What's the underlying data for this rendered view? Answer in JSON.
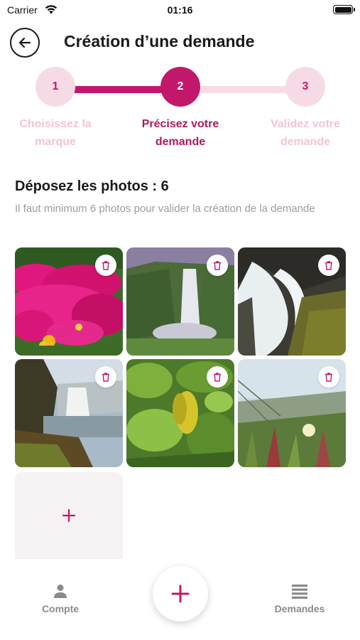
{
  "status_bar": {
    "carrier": "Carrier",
    "time": "01:16",
    "icons": [
      "wifi-icon",
      "battery-icon"
    ]
  },
  "header": {
    "title": "Création d’une demande",
    "back_icon": "arrow-left-icon"
  },
  "stepper": {
    "current_step": 2,
    "steps": [
      {
        "number": "1",
        "label": "Choisissez la marque"
      },
      {
        "number": "2",
        "label": "Précisez votre demande"
      },
      {
        "number": "3",
        "label": "Validez votre demande"
      }
    ]
  },
  "photos_section": {
    "title": "Déposez les photos : 6",
    "subtitle": "Il faut minimum 6 photos pour valider la création de la demande",
    "photos": [
      {
        "subject": "pink-flowers"
      },
      {
        "subject": "waterfall-cliff"
      },
      {
        "subject": "waterfall-rocks"
      },
      {
        "subject": "waterfall-coast"
      },
      {
        "subject": "green-leaves"
      },
      {
        "subject": "coastal-plants"
      }
    ],
    "delete_icon": "trash-icon",
    "add_icon": "plus-icon"
  },
  "bottom_nav": {
    "items": [
      {
        "label": "Compte",
        "icon": "person-icon"
      },
      {
        "label": "Demandes",
        "icon": "list-icon"
      }
    ],
    "fab_icon": "plus-icon"
  },
  "colors": {
    "accent": "#c2186b",
    "accent_light": "#f6dbe7",
    "muted_text": "#9c9c9c",
    "add_tile_bg": "#f6f1f3"
  }
}
